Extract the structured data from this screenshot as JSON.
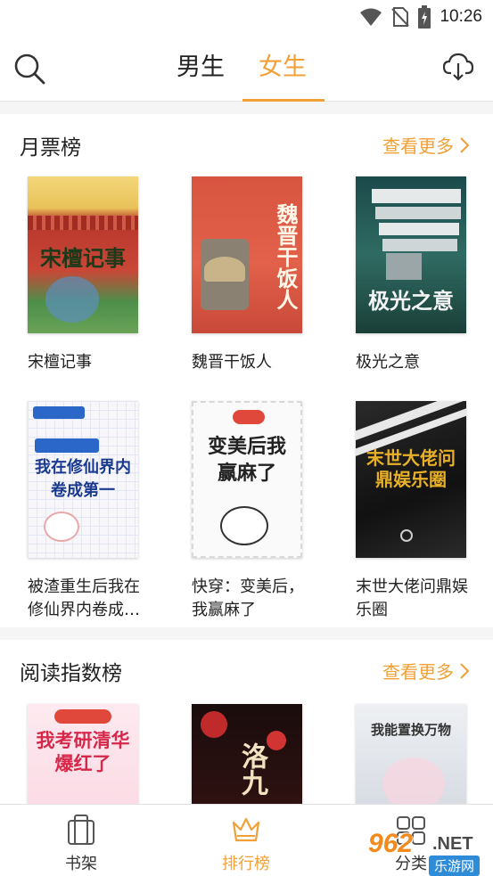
{
  "status_bar": {
    "time": "10:26"
  },
  "header": {
    "tabs": [
      {
        "label": "男生",
        "active": false
      },
      {
        "label": "女生",
        "active": true
      }
    ],
    "accent_color": "#f0a036"
  },
  "sections": [
    {
      "title": "月票榜",
      "more_label": "查看更多",
      "books": [
        {
          "title": "宋檀记事",
          "cover_text": "宋檀记事"
        },
        {
          "title": "魏晋干饭人",
          "cover_text": "魏晋干饭人"
        },
        {
          "title": "极光之意",
          "cover_text": "极光之意"
        },
        {
          "title": "被渣重生后我在修仙界内卷成第一",
          "cover_text": "我在修仙界内卷成第一"
        },
        {
          "title": "快穿：变美后，我赢麻了",
          "cover_text": "变美后我赢麻了"
        },
        {
          "title": "末世大佬问鼎娱乐圈",
          "cover_text": "末世大佬问鼎娱乐圈"
        }
      ]
    },
    {
      "title": "阅读指数榜",
      "more_label": "查看更多",
      "books": [
        {
          "cover_text": "我考研清华爆红了"
        },
        {
          "cover_text": "洛九"
        },
        {
          "cover_text": "我能置换万物"
        }
      ]
    }
  ],
  "bottom_nav": [
    {
      "label": "书架",
      "icon": "bookshelf-icon",
      "active": false
    },
    {
      "label": "排行榜",
      "icon": "crown-icon",
      "active": true
    },
    {
      "label": "分类",
      "icon": "grid-icon",
      "active": false
    }
  ],
  "watermark": {
    "main": "962",
    "suffix": ".NET",
    "sub": "乐游网"
  }
}
